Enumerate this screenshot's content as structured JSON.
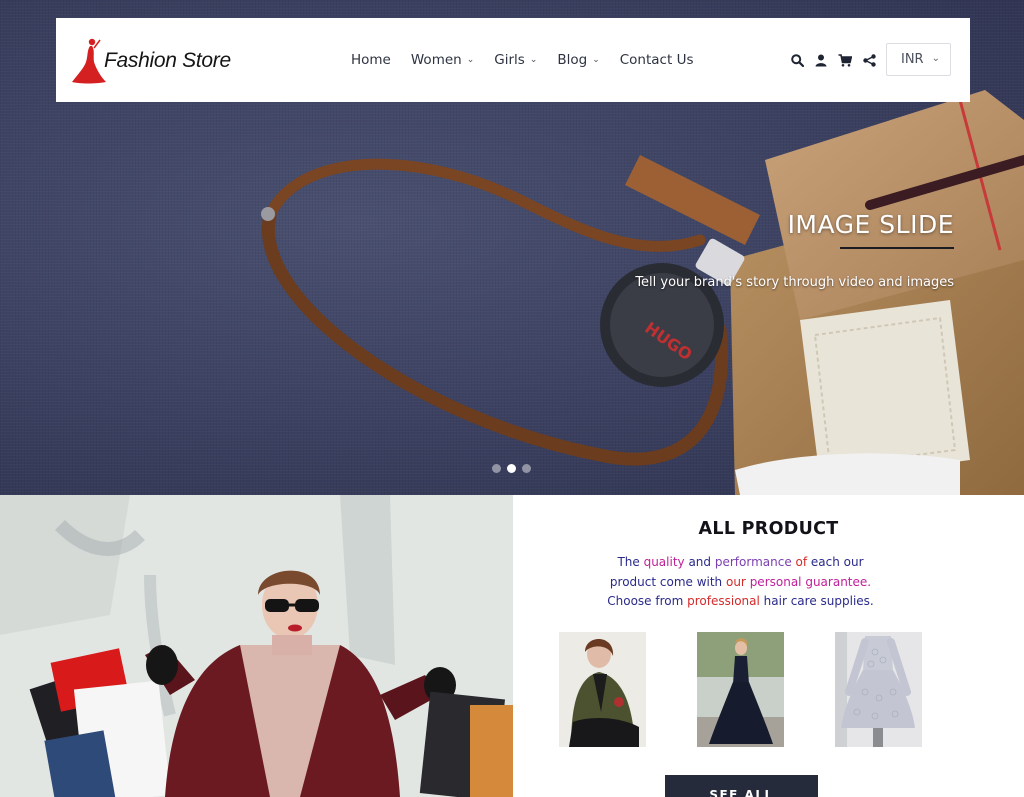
{
  "brand": {
    "name": "Fashion Store",
    "accent": "#d42020"
  },
  "nav": {
    "items": [
      {
        "label": "Home",
        "has_dropdown": false
      },
      {
        "label": "Women",
        "has_dropdown": true
      },
      {
        "label": "Girls",
        "has_dropdown": true
      },
      {
        "label": "Blog",
        "has_dropdown": true
      },
      {
        "label": "Contact Us",
        "has_dropdown": false
      }
    ],
    "caret": "⌄"
  },
  "header_icons": [
    "search-icon",
    "user-icon",
    "cart-icon",
    "share-icon"
  ],
  "currency": {
    "selected": "INR"
  },
  "hero": {
    "title": "IMAGE SLIDE",
    "subtitle": "Tell your brand's story through video and images",
    "slides_count": 3,
    "active_slide": 2
  },
  "all_product": {
    "title": "ALL PRODUCT",
    "description_lines": [
      [
        {
          "t": "The ",
          "c": "#2a2a8a"
        },
        {
          "t": "quality",
          "c": "#c0209a"
        },
        {
          "t": " and ",
          "c": "#2a2a8a"
        },
        {
          "t": "performance",
          "c": "#7b3fb0"
        },
        {
          "t": " of ",
          "c": "#d42a2a"
        },
        {
          "t": "each our",
          "c": "#2a2a8a"
        }
      ],
      [
        {
          "t": "product come with ",
          "c": "#2a2a8a"
        },
        {
          "t": "our",
          "c": "#d42a2a"
        },
        {
          "t": " personal guarantee.",
          "c": "#c0209a"
        }
      ],
      [
        {
          "t": "Choose from ",
          "c": "#2a2a8a"
        },
        {
          "t": "professional",
          "c": "#d42a2a"
        },
        {
          "t": " hair care supplies.",
          "c": "#2a2a8a"
        }
      ]
    ],
    "see_all_label": "SEE ALL"
  }
}
